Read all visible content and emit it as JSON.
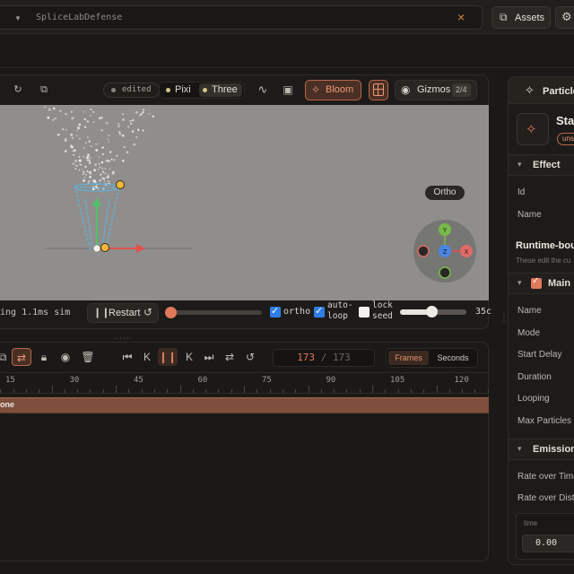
{
  "topbar": {
    "project_name": "SpliceLabDefense",
    "assets_label": "Assets"
  },
  "viewport": {
    "edited_label": "edited",
    "renderer_pixi": "Pixi",
    "renderer_three": "Three",
    "bloom_label": "Bloom",
    "gizmos_label": "Gizmos",
    "gizmos_count": "2/4",
    "ortho_view_label": "Ortho",
    "axis_y": "Y",
    "axis_x": "X",
    "axis_z": "Z"
  },
  "footer": {
    "stats": "ing  1.1ms sim",
    "restart_label": "Restart",
    "time_progress": 0.0,
    "ortho_label": "ortho",
    "ortho_checked": true,
    "autoloop_line1": "auto-",
    "autoloop_line2": "loop",
    "autoloop_checked": true,
    "lockseed_line1": "lock",
    "lockseed_line2": "seed",
    "lockseed_checked": false,
    "speed_fraction": 0.47,
    "speed_value": "35c"
  },
  "timeline": {
    "frame_current": "173",
    "frame_sep": "/",
    "frame_total": "173",
    "unit_frames": "Frames",
    "unit_seconds": "Seconds",
    "ticks": [
      "15",
      "30",
      "45",
      "60",
      "75",
      "90",
      "105",
      "120"
    ],
    "track_label": "one"
  },
  "panel": {
    "tab_label": "Particles",
    "effect_title": "Sta",
    "effect_badge": "uns",
    "section_effect": "Effect",
    "field_id": "Id",
    "field_name": "Name",
    "runtime_title": "Runtime-bou",
    "runtime_sub": "These edit the cu",
    "section_main": "Main",
    "main_fields": [
      "Name",
      "Mode",
      "Start Delay",
      "Duration",
      "Looping",
      "Max Particles"
    ],
    "section_emission": "Emission",
    "emission_fields": [
      "Rate over Time",
      "Rate over Dista"
    ],
    "curve_col_label": "time",
    "curve_value": "0.00"
  },
  "colors": {
    "accent": "#e07a5c",
    "accent_border": "#b8674a",
    "checkbox_blue": "#2f7ee8",
    "viewport_bg": "#8f8e8c",
    "track": "#7d4f3c"
  }
}
